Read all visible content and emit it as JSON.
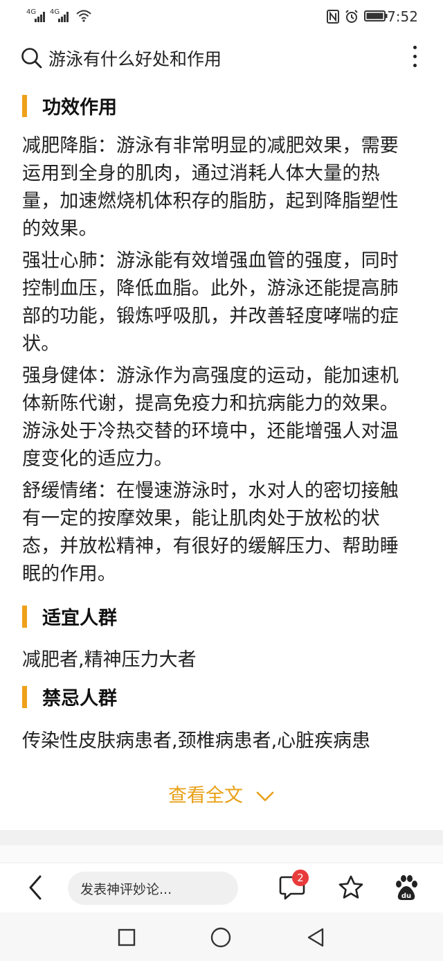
{
  "status_bar": {
    "sim1": "4G",
    "sim2": "4G",
    "time": "7:52"
  },
  "search": {
    "query": "游泳有什么好处和作用"
  },
  "article": {
    "sections": [
      {
        "title": "功效作用",
        "paragraphs": [
          "减肥降脂：游泳有非常明显的减肥效果，需要运用到全身的肌肉，通过消耗人体大量的热量，加速燃烧机体积存的脂肪，起到降脂塑性的效果。",
          "强壮心肺：游泳能有效增强血管的强度，同时控制血压，降低血脂。此外，游泳还能提高肺部的功能，锻炼呼吸肌，并改善轻度哮喘的症状。",
          "强身健体：游泳作为高强度的运动，能加速机体新陈代谢，提高免疫力和抗病能力的效果。游泳处于冷热交替的环境中，还能增强人对温度变化的适应力。",
          "舒缓情绪：在慢速游泳时，水对人的密切接触有一定的按摩效果，能让肌肉处于放松的状态，并放松精神，有很好的缓解压力、帮助睡眠的作用。"
        ]
      },
      {
        "title": "适宜人群",
        "text": "减肥者,精神压力大者"
      },
      {
        "title": "禁忌人群",
        "text": "传染性皮肤病患者,颈椎病患者,心脏疾病患"
      }
    ],
    "read_more": "查看全文"
  },
  "bottom_bar": {
    "comment_placeholder": "发表神评妙论...",
    "comment_count": "2"
  },
  "colors": {
    "accent": "#f0a11a",
    "read_more": "#e8a017",
    "badge": "#e83b3b"
  },
  "icons": [
    "signal-icon",
    "wifi-icon",
    "nfc-icon",
    "alarm-icon",
    "battery-icon",
    "search-icon",
    "more-vert-icon",
    "chevron-down-icon",
    "back-arrow-icon",
    "comment-icon",
    "star-icon",
    "baidu-paw-icon",
    "nav-recent-icon",
    "nav-home-icon",
    "nav-back-icon"
  ]
}
